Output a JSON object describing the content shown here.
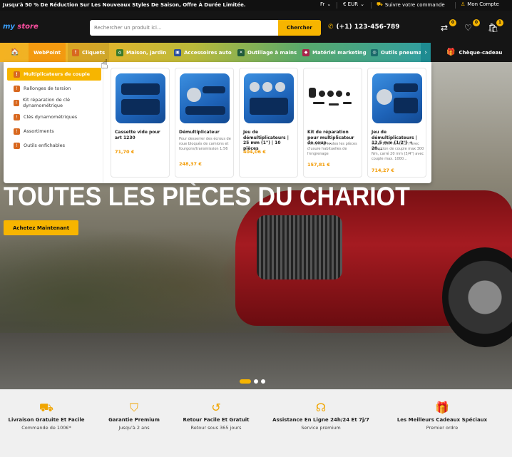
{
  "topbar": {
    "promo": "Jusqu'à 50 % De Réduction Sur Les Nouveaux Styles De Saison, Offre À Durée Limitée.",
    "language": "Fr",
    "currency": "€ EUR",
    "track_order": "Suivre votre commande",
    "account": "Mon Compte"
  },
  "header": {
    "logo_a": "my",
    "logo_b": " store",
    "search_placeholder": "Rechercher un produit ici...",
    "search_button": "Chercher",
    "phone": "(+1) 123-456-789",
    "compare_count": "0",
    "wishlist_count": "0",
    "cart_count": "1"
  },
  "nav": {
    "items": [
      {
        "label": "WebPoint"
      },
      {
        "label": "Cliquets"
      },
      {
        "label": "Maison, jardin"
      },
      {
        "label": "Accessoires auto"
      },
      {
        "label": "Outillage à mains"
      },
      {
        "label": "Matériel marketing"
      },
      {
        "label": "Outils pneuma"
      }
    ],
    "gift": "Chèque-cadeau"
  },
  "submenu": {
    "items": [
      {
        "label": "Multiplicateurs de couple"
      },
      {
        "label": "Rallonges de torsion"
      },
      {
        "label": "Kit réparation de clé dynamométrique"
      },
      {
        "label": "Clés dynamométriques"
      },
      {
        "label": "Assortiments"
      },
      {
        "label": "Outils enfichables"
      }
    ]
  },
  "products": [
    {
      "name": "Cassette vide pour art 1230",
      "desc": "",
      "price": "71,70 €"
    },
    {
      "name": "Démultiplicateur",
      "desc": "Pour desserrer des écrous de roue bloqués de camions et fourgons/transmission 1:56",
      "price": "248,37 €"
    },
    {
      "name": "Jeu de démultiplicateurs | 25 mm (1\") | 10 pièces",
      "desc": "",
      "price": "404,06 €"
    },
    {
      "name": "Kit de réparation pour multiplicateur de coup...",
      "desc": "Comprend toutes les pièces d'usure habituelles de l'engrenage",
      "price": "157,81 €"
    },
    {
      "name": "Jeu de démultiplicateurs | 12,5 mm (1/2\") + 20...",
      "desc": "Carré 12,5 mm (1/2\") avec réception de couple max 300 Nm, carré 20 mm (3/4\") avec couple max. 1000...",
      "price": "714,27 €"
    }
  ],
  "hero": {
    "title": "TOUTES LES PIÈCES DU CHARIOT",
    "button": "Achetez Maintenant",
    "slides": 3,
    "active_slide": 1
  },
  "features": [
    {
      "icon": "truck-icon",
      "title": "Livraison Gratuite Et Facile",
      "sub": "Commande de 100€*"
    },
    {
      "icon": "shield-check-icon",
      "title": "Garantie Premium",
      "sub": "Jusqu'à 2 ans"
    },
    {
      "icon": "return-icon",
      "title": "Retour Facile Et Gratuit",
      "sub": "Retour sous 365 jours"
    },
    {
      "icon": "headset-icon",
      "title": "Assistance En Ligne 24h/24 Et 7j/7",
      "sub": "Service premium"
    },
    {
      "icon": "gift-icon",
      "title": "Les Meilleurs Cadeaux Spéciaux",
      "sub": "Premier ordre"
    }
  ],
  "colors": {
    "accent": "#f7b500",
    "header_bg": "#151515",
    "price": "#f29a00"
  }
}
